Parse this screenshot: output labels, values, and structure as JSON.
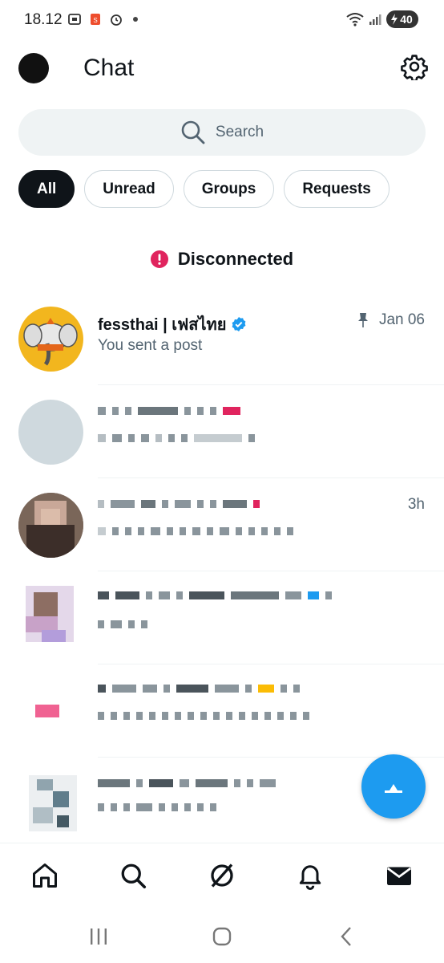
{
  "status_bar": {
    "time": "18.12",
    "battery": "40"
  },
  "header": {
    "title": "Chat"
  },
  "search": {
    "placeholder": "Search"
  },
  "tabs": [
    {
      "label": "All",
      "active": true
    },
    {
      "label": "Unread",
      "active": false
    },
    {
      "label": "Groups",
      "active": false
    },
    {
      "label": "Requests",
      "active": false
    }
  ],
  "connection": {
    "status": "Disconnected",
    "color": "#e0245e"
  },
  "conversations": [
    {
      "name": "fessthai | เฟสไทย",
      "verified": true,
      "pinned": true,
      "time": "Jan 06",
      "preview": "You sent a post"
    },
    {
      "name": "",
      "time": "",
      "preview": ""
    },
    {
      "name": "",
      "time": "3h",
      "preview": ""
    },
    {
      "name": "",
      "time": "",
      "preview": ""
    },
    {
      "name": "",
      "time": "",
      "preview": ""
    },
    {
      "name": "",
      "time": "",
      "preview": ""
    }
  ],
  "colors": {
    "accent": "#1d9bf0",
    "text": "#0f1419",
    "muted": "#536471"
  },
  "icons": {
    "nav": [
      "home-icon",
      "search-icon",
      "grok-icon",
      "notifications-icon",
      "messages-icon"
    ],
    "fab": "new-message-icon"
  }
}
